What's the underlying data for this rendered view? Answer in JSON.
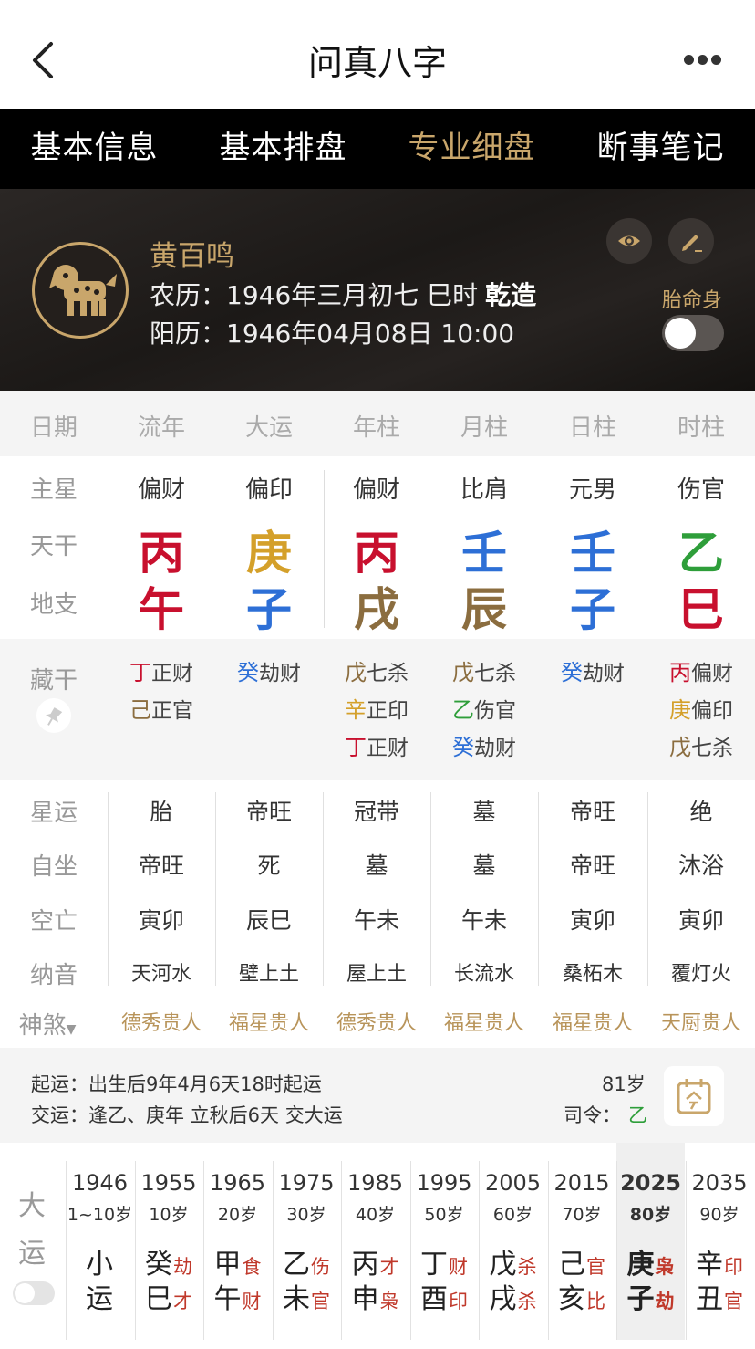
{
  "header": {
    "title": "问真八字"
  },
  "tabs": [
    "基本信息",
    "基本排盘",
    "专业细盘",
    "断事笔记"
  ],
  "profile": {
    "name": "黄百鸣",
    "lunar": "农历：1946年三月初七 巳时",
    "gender_tag": "乾造",
    "solar": "阳历：1946年04月08日 10:00",
    "taiming_label": "胎命身"
  },
  "columns": [
    "日期",
    "流年",
    "大运",
    "年柱",
    "月柱",
    "日柱",
    "时柱"
  ],
  "row_labels": {
    "main_star": "主星",
    "tiangan": "天干",
    "dizhi": "地支",
    "canggan": "藏干",
    "xingyun": "星运",
    "zizuo": "自坐",
    "kongwang": "空亡",
    "nayin": "纳音",
    "shensha": "神煞"
  },
  "main_star": [
    "偏财",
    "偏印",
    "偏财",
    "比肩",
    "元男",
    "伤官"
  ],
  "tiangan": [
    {
      "char": "丙",
      "color": "#c8102e"
    },
    {
      "char": "庚",
      "color": "#d4a02a"
    },
    {
      "char": "丙",
      "color": "#c8102e"
    },
    {
      "char": "壬",
      "color": "#2d6fd6"
    },
    {
      "char": "壬",
      "color": "#2d6fd6"
    },
    {
      "char": "乙",
      "color": "#2e9e3a"
    }
  ],
  "dizhi": [
    {
      "char": "午",
      "color": "#c8102e"
    },
    {
      "char": "子",
      "color": "#2d6fd6"
    },
    {
      "char": "戌",
      "color": "#8b6d3f"
    },
    {
      "char": "辰",
      "color": "#8b6d3f"
    },
    {
      "char": "子",
      "color": "#2d6fd6"
    },
    {
      "char": "巳",
      "color": "#c8102e"
    }
  ],
  "canggan": [
    [
      {
        "g": "丁",
        "c": "#c8102e",
        "t": "正财"
      },
      {
        "g": "己",
        "c": "#8b6d3f",
        "t": "正官"
      }
    ],
    [
      {
        "g": "癸",
        "c": "#2d6fd6",
        "t": "劫财"
      }
    ],
    [
      {
        "g": "戊",
        "c": "#8b6d3f",
        "t": "七杀"
      },
      {
        "g": "辛",
        "c": "#d4a02a",
        "t": "正印"
      },
      {
        "g": "丁",
        "c": "#c8102e",
        "t": "正财"
      }
    ],
    [
      {
        "g": "戊",
        "c": "#8b6d3f",
        "t": "七杀"
      },
      {
        "g": "乙",
        "c": "#2e9e3a",
        "t": "伤官"
      },
      {
        "g": "癸",
        "c": "#2d6fd6",
        "t": "劫财"
      }
    ],
    [
      {
        "g": "癸",
        "c": "#2d6fd6",
        "t": "劫财"
      }
    ],
    [
      {
        "g": "丙",
        "c": "#c8102e",
        "t": "偏财"
      },
      {
        "g": "庚",
        "c": "#d4a02a",
        "t": "偏印"
      },
      {
        "g": "戊",
        "c": "#8b6d3f",
        "t": "七杀"
      }
    ]
  ],
  "xingyun": [
    "胎",
    "帝旺",
    "冠带",
    "墓",
    "帝旺",
    "绝"
  ],
  "zizuo": [
    "帝旺",
    "死",
    "墓",
    "墓",
    "帝旺",
    "沐浴"
  ],
  "kongwang": [
    "寅卯",
    "辰巳",
    "午未",
    "午未",
    "寅卯",
    "寅卯"
  ],
  "nayin": [
    "天河水",
    "壁上土",
    "屋上土",
    "长流水",
    "桑柘木",
    "覆灯火"
  ],
  "shensha": [
    "德秀贵人",
    "福星贵人",
    "德秀贵人",
    "福星贵人",
    "福星贵人",
    "天厨贵人"
  ],
  "qiyun": {
    "line1": "起运：出生后9年4月6天18时起运",
    "line2": "交运：逢乙、庚年 立秋后6天 交大运",
    "age": "81岁",
    "siling_label": "司令：",
    "siling_value": "乙"
  },
  "dayun_label": [
    "大",
    "运"
  ],
  "dayun": [
    {
      "year": "1946",
      "age": "1~10岁",
      "g": "小",
      "gs": "",
      "z": "运",
      "zs": ""
    },
    {
      "year": "1955",
      "age": "10岁",
      "g": "癸",
      "gs": "劫",
      "z": "巳",
      "zs": "才"
    },
    {
      "year": "1965",
      "age": "20岁",
      "g": "甲",
      "gs": "食",
      "z": "午",
      "zs": "财"
    },
    {
      "year": "1975",
      "age": "30岁",
      "g": "乙",
      "gs": "伤",
      "z": "未",
      "zs": "官"
    },
    {
      "year": "1985",
      "age": "40岁",
      "g": "丙",
      "gs": "才",
      "z": "申",
      "zs": "枭"
    },
    {
      "year": "1995",
      "age": "50岁",
      "g": "丁",
      "gs": "财",
      "z": "酉",
      "zs": "印"
    },
    {
      "year": "2005",
      "age": "60岁",
      "g": "戊",
      "gs": "杀",
      "z": "戌",
      "zs": "杀"
    },
    {
      "year": "2015",
      "age": "70岁",
      "g": "己",
      "gs": "官",
      "z": "亥",
      "zs": "比"
    },
    {
      "year": "2025",
      "age": "80岁",
      "g": "庚",
      "gs": "枭",
      "z": "子",
      "zs": "劫"
    },
    {
      "year": "2035",
      "age": "90岁",
      "g": "辛",
      "gs": "印",
      "z": "丑",
      "zs": "官"
    }
  ]
}
